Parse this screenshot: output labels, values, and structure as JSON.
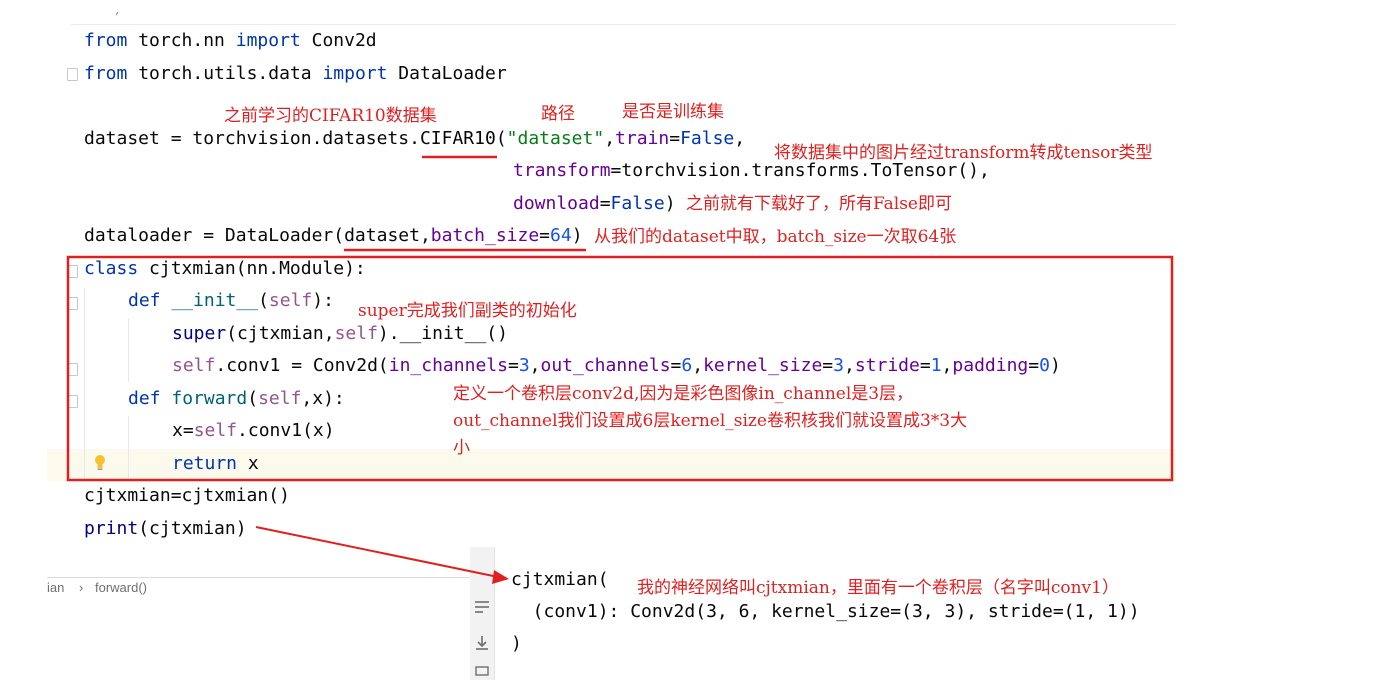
{
  "editor": {
    "top_fragment": "   )",
    "lines": {
      "l1_kw_from": "from",
      "l1_mod": " torch.nn ",
      "l1_kw_import": "import",
      "l1_name": " Conv2d",
      "l2_kw_from": "from",
      "l2_mod": " torch.utils.data ",
      "l2_kw_import": "import",
      "l2_name": " DataLoader",
      "l4_a": "dataset = torchvision.datasets.",
      "l4_cls": "CIFAR10",
      "l4_paren": "(",
      "l4_str": "\"dataset\"",
      "l4_comma": ",",
      "l4_train": "train",
      "l4_eq": "=",
      "l4_false": "False",
      "l4_end": ",",
      "l5_transform": "transform",
      "l5_rest": "=torchvision.transforms.ToTensor(),",
      "l6_download": "download",
      "l6_eq": "=",
      "l6_false": "False",
      "l6_end": ")",
      "l7_a": "dataloader = DataLoader(",
      "l7_ds": "dataset",
      "l7_comma": ",",
      "l7_bs": "batch_size",
      "l7_eq": "=",
      "l7_num": "64",
      "l7_end": ")",
      "l8_kw": "class",
      "l8_rest": " cjtxmian(nn.Module):",
      "l9_kw": "def",
      "l9_name": " __init__",
      "l9_p1": "(",
      "l9_self": "self",
      "l9_end": "):",
      "l10_super": "super",
      "l10_a": "(cjtxmian,",
      "l10_self": "self",
      "l10_b": ").__init__()",
      "l11_self": "self",
      "l11_a": ".conv1 = Conv2d(",
      "l11_p1": "in_channels",
      "l11_v1": "3",
      "l11_p2": "out_channels",
      "l11_v2": "6",
      "l11_p3": "kernel_size",
      "l11_v3": "3",
      "l11_p4": "stride",
      "l11_v4": "1",
      "l11_p5": "padding",
      "l11_v5": "0",
      "l12_kw": "def",
      "l12_name": " forward",
      "l12_p": "(",
      "l12_self": "self",
      "l12_end": ",x):",
      "l13_a": "x=",
      "l13_self": "self",
      "l13_b": ".conv1(x)",
      "l14_kw": "return",
      "l14_rest": " x",
      "l15": "cjtxmian=cjtxmian()",
      "l16_kw": "print",
      "l16_rest": "(cjtxmian)"
    }
  },
  "breadcrumb": {
    "item1": "ian",
    "sep": "›",
    "item2": "forward()"
  },
  "console": {
    "line1": "cjtxmian(",
    "line2": "  (conv1): Conv2d(3, 6, kernel_size=(3, 3), stride=(1, 1))",
    "line3": ")"
  },
  "annotations": {
    "cifar": "之前学习的CIFAR10数据集",
    "path": "路径",
    "train": "是否是训练集",
    "transform": "将数据集中的图片经过transform转成tensor类型",
    "download": "之前就有下载好了，所有False即可",
    "batch": "从我们的dataset中取，batch_size一次取64张",
    "super": "super完成我们副类的初始化",
    "conv_line1": "定义一个卷积层conv2d,因为是彩色图像in_channel是3层，",
    "conv_line2": "out_channel我们设置成6层kernel_size卷积核我们就设置成3*3大",
    "conv_line3": "小",
    "output": "我的神经网络叫cjtxmian，里面有一个卷积层（名字叫conv1）"
  },
  "colors": {
    "annotation_red": "#e02020",
    "keyword": "#0033b3",
    "self": "#94558d",
    "number": "#1750eb",
    "string": "#067d17",
    "param": "#660099"
  }
}
